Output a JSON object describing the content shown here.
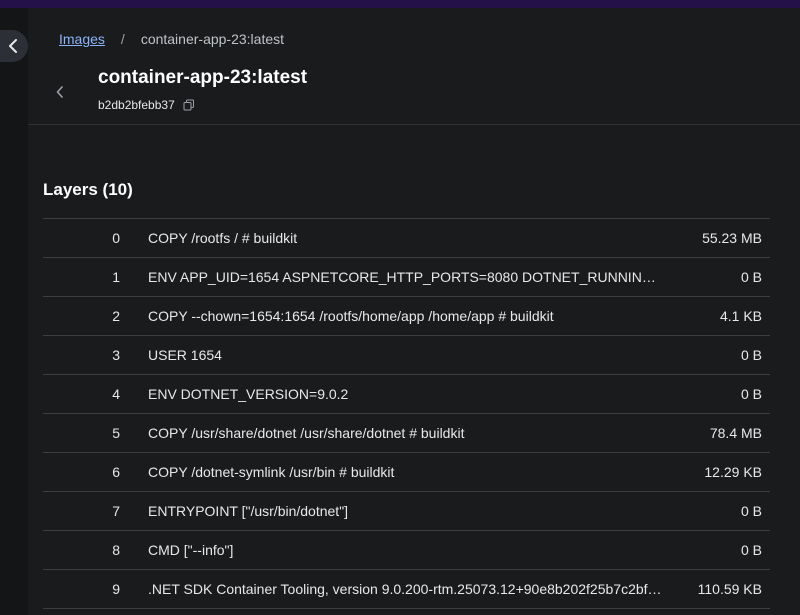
{
  "breadcrumb": {
    "root": "Images",
    "separator": "/",
    "current": "container-app-23:latest"
  },
  "header": {
    "title": "container-app-23:latest",
    "image_id": "b2db2bfebb37"
  },
  "layers_section": {
    "title": "Layers (10)"
  },
  "layers": [
    {
      "index": "0",
      "command": "COPY /rootfs / # buildkit",
      "size": "55.23 MB"
    },
    {
      "index": "1",
      "command": "ENV APP_UID=1654 ASPNETCORE_HTTP_PORTS=8080 DOTNET_RUNNING_IN_…",
      "size": "0 B"
    },
    {
      "index": "2",
      "command": "COPY --chown=1654:1654 /rootfs/home/app /home/app # buildkit",
      "size": "4.1 KB"
    },
    {
      "index": "3",
      "command": "USER 1654",
      "size": "0 B"
    },
    {
      "index": "4",
      "command": "ENV DOTNET_VERSION=9.0.2",
      "size": "0 B"
    },
    {
      "index": "5",
      "command": "COPY /usr/share/dotnet /usr/share/dotnet # buildkit",
      "size": "78.4 MB"
    },
    {
      "index": "6",
      "command": "COPY /dotnet-symlink /usr/bin # buildkit",
      "size": "12.29 KB"
    },
    {
      "index": "7",
      "command": "ENTRYPOINT [\"/usr/bin/dotnet\"]",
      "size": "0 B"
    },
    {
      "index": "8",
      "command": "CMD [\"--info\"]",
      "size": "0 B"
    },
    {
      "index": "9",
      "command": ".NET SDK Container Tooling, version 9.0.200-rtm.25073.12+90e8b202f25b7c2bf…",
      "size": "110.59 KB"
    }
  ],
  "icons": {
    "collapse": "chevron-left-icon",
    "back": "chevron-left-icon",
    "copy": "copy-icon"
  },
  "colors": {
    "accent_bar": "#24114a",
    "link": "#8ab4f8",
    "background": "#1a1b1d"
  }
}
